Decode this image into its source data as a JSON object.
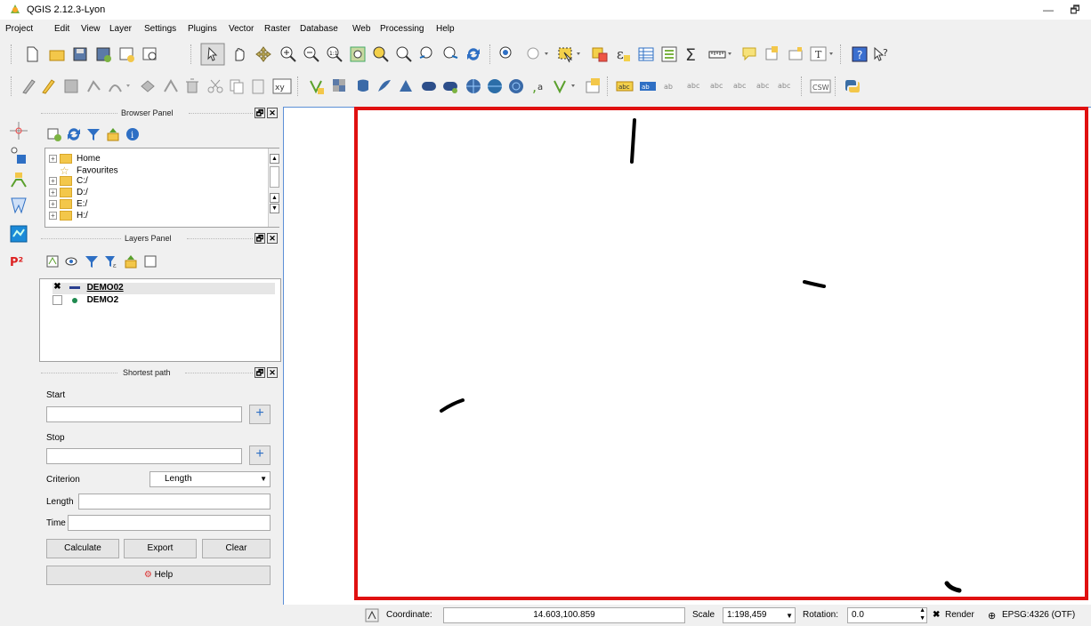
{
  "window": {
    "title": "QGIS 2.12.3-Lyon",
    "minimize": "—",
    "maximize": "🗗"
  },
  "menu": [
    "Project",
    "Edit",
    "View",
    "Layer",
    "Settings",
    "Plugins",
    "Vector",
    "Raster",
    "Database",
    "Web",
    "Processing",
    "Help"
  ],
  "browser_panel": {
    "title": "Browser Panel",
    "items": [
      "Home",
      "Favourites",
      "C:/",
      "D:/",
      "E:/",
      "H:/"
    ]
  },
  "layers_panel": {
    "title": "Layers Panel",
    "layers": [
      {
        "name": "DEMO02",
        "checked": true
      },
      {
        "name": "DEMO2",
        "checked": false
      }
    ]
  },
  "shortest_path": {
    "title": "Shortest path",
    "start_label": "Start",
    "stop_label": "Stop",
    "criterion_label": "Criterion",
    "criterion_value": "Length",
    "length_label": "Length",
    "time_label": "Time",
    "calculate": "Calculate",
    "export": "Export",
    "clear": "Clear",
    "help": "Help"
  },
  "dock_buttons": {
    "float": "🗗",
    "close": "✕"
  },
  "status": {
    "coordinate_label": "Coordinate:",
    "coordinate_value": "14.603,100.859",
    "scale_label": "Scale",
    "scale_value": "1:198,459",
    "rotation_label": "Rotation:",
    "rotation_value": "0.0",
    "render_label": "Render",
    "render_checked": true,
    "crs": "EPSG:4326 (OTF)"
  },
  "colors": {
    "accent_red": "#e01010",
    "canvas_border": "#5c8fd6"
  }
}
